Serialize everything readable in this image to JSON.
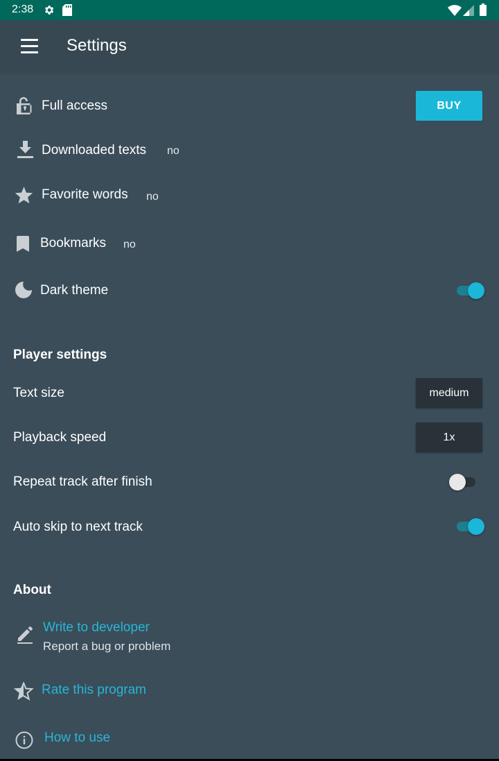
{
  "status_bar": {
    "time": "2:38"
  },
  "app_bar": {
    "title": "Settings"
  },
  "account": {
    "full_access": {
      "label": "Full access",
      "button": "BUY"
    },
    "downloaded_texts": {
      "label": "Downloaded texts",
      "value": "no"
    },
    "favorite_words": {
      "label": "Favorite words",
      "value": "no"
    },
    "bookmarks": {
      "label": "Bookmarks",
      "value": "no"
    },
    "dark_theme": {
      "label": "Dark theme",
      "enabled": true
    }
  },
  "player": {
    "header": "Player settings",
    "text_size": {
      "label": "Text size",
      "value": "medium"
    },
    "playback_speed": {
      "label": "Playback speed",
      "value": "1x"
    },
    "repeat_track": {
      "label": "Repeat track after finish",
      "enabled": false
    },
    "auto_skip": {
      "label": "Auto skip to next track",
      "enabled": true
    }
  },
  "about": {
    "header": "About",
    "write_developer": {
      "label": "Write to developer",
      "sublabel": "Report a bug or problem"
    },
    "rate": {
      "label": "Rate this program"
    },
    "how_to_use": {
      "label": "How to use"
    }
  },
  "icons": {
    "settings": "gear-icon",
    "sd_card": "sd-card-icon",
    "wifi": "wifi-icon",
    "signal": "signal-icon",
    "battery": "battery-icon",
    "menu": "menu-icon",
    "full_access": "lock-icon",
    "downloaded": "download-icon",
    "favorite": "star-icon",
    "bookmarks": "bookmark-icon",
    "dark_theme": "moon-icon",
    "write": "pencil-icon",
    "rate": "half-star-icon",
    "how_to_use": "info-icon"
  },
  "colors": {
    "background": "#3a4d59",
    "app_bar": "#384852",
    "status_bar": "#00695c",
    "accent": "#1bb7d9",
    "link": "#29b6d6",
    "select_button": "#283238"
  }
}
